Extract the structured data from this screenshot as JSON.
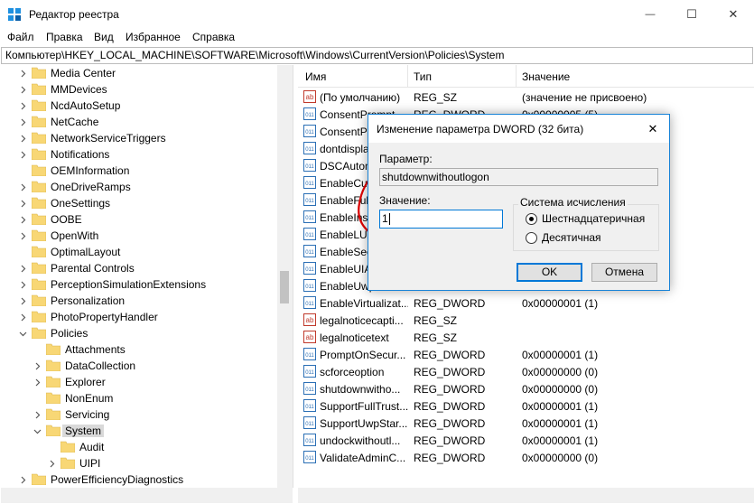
{
  "window": {
    "title": "Редактор реестра",
    "controls": {
      "minimize": "—",
      "maximize": "☐",
      "close": "✕"
    }
  },
  "menu": [
    "Файл",
    "Правка",
    "Вид",
    "Избранное",
    "Справка"
  ],
  "address": "Компьютер\\HKEY_LOCAL_MACHINE\\SOFTWARE\\Microsoft\\Windows\\CurrentVersion\\Policies\\System",
  "tree": [
    {
      "label": "Media Center",
      "expander": "collapsed"
    },
    {
      "label": "MMDevices",
      "expander": "collapsed"
    },
    {
      "label": "NcdAutoSetup",
      "expander": "collapsed"
    },
    {
      "label": "NetCache",
      "expander": "collapsed"
    },
    {
      "label": "NetworkServiceTriggers",
      "expander": "collapsed"
    },
    {
      "label": "Notifications",
      "expander": "collapsed"
    },
    {
      "label": "OEMInformation",
      "expander": "none"
    },
    {
      "label": "OneDriveRamps",
      "expander": "collapsed"
    },
    {
      "label": "OneSettings",
      "expander": "collapsed"
    },
    {
      "label": "OOBE",
      "expander": "collapsed"
    },
    {
      "label": "OpenWith",
      "expander": "collapsed"
    },
    {
      "label": "OptimalLayout",
      "expander": "none"
    },
    {
      "label": "Parental Controls",
      "expander": "collapsed"
    },
    {
      "label": "PerceptionSimulationExtensions",
      "expander": "collapsed"
    },
    {
      "label": "Personalization",
      "expander": "collapsed"
    },
    {
      "label": "PhotoPropertyHandler",
      "expander": "collapsed"
    },
    {
      "label": "Policies",
      "expander": "expanded"
    },
    {
      "label": "Attachments",
      "expander": "none"
    },
    {
      "label": "DataCollection",
      "expander": "collapsed"
    },
    {
      "label": "Explorer",
      "expander": "collapsed"
    },
    {
      "label": "NonEnum",
      "expander": "none"
    },
    {
      "label": "Servicing",
      "expander": "collapsed"
    },
    {
      "label": "System",
      "expander": "expanded",
      "selected": true
    },
    {
      "label": "Audit",
      "expander": "none"
    },
    {
      "label": "UIPI",
      "expander": "collapsed"
    },
    {
      "label": "PowerEfficiencyDiagnostics",
      "expander": "collapsed"
    }
  ],
  "list": {
    "headers": [
      "Имя",
      "Тип",
      "Значение"
    ],
    "rows": [
      {
        "icon": "string",
        "name": "(По умолчанию)",
        "type": "REG_SZ",
        "value": "(значение не присвоено)"
      },
      {
        "icon": "dword",
        "name": "ConsentPrompt...",
        "type": "REG_DWORD",
        "value": "0x00000005 (5)"
      },
      {
        "icon": "dword",
        "name": "ConsentPr...",
        "type": "",
        "value": ""
      },
      {
        "icon": "dword",
        "name": "dontdispla...",
        "type": "",
        "value": ""
      },
      {
        "icon": "dword",
        "name": "DSCAutom...",
        "type": "",
        "value": ""
      },
      {
        "icon": "dword",
        "name": "EnableCur...",
        "type": "",
        "value": ""
      },
      {
        "icon": "dword",
        "name": "EnableFull...",
        "type": "",
        "value": ""
      },
      {
        "icon": "dword",
        "name": "EnableInst...",
        "type": "",
        "value": ""
      },
      {
        "icon": "dword",
        "name": "EnableLUA",
        "type": "",
        "value": ""
      },
      {
        "icon": "dword",
        "name": "EnableSec...",
        "type": "",
        "value": ""
      },
      {
        "icon": "dword",
        "name": "EnableUIA...",
        "type": "",
        "value": ""
      },
      {
        "icon": "dword",
        "name": "EnableUwp...",
        "type": "",
        "value": ""
      },
      {
        "icon": "dword",
        "name": "EnableVirtualizat...",
        "type": "REG_DWORD",
        "value": "0x00000001 (1)"
      },
      {
        "icon": "string",
        "name": "legalnoticecapti...",
        "type": "REG_SZ",
        "value": ""
      },
      {
        "icon": "string",
        "name": "legalnoticetext",
        "type": "REG_SZ",
        "value": ""
      },
      {
        "icon": "dword",
        "name": "PromptOnSecur...",
        "type": "REG_DWORD",
        "value": "0x00000001 (1)"
      },
      {
        "icon": "dword",
        "name": "scforceoption",
        "type": "REG_DWORD",
        "value": "0x00000000 (0)"
      },
      {
        "icon": "dword",
        "name": "shutdownwitho...",
        "type": "REG_DWORD",
        "value": "0x00000000 (0)"
      },
      {
        "icon": "dword",
        "name": "SupportFullTrust...",
        "type": "REG_DWORD",
        "value": "0x00000001 (1)"
      },
      {
        "icon": "dword",
        "name": "SupportUwpStar...",
        "type": "REG_DWORD",
        "value": "0x00000001 (1)"
      },
      {
        "icon": "dword",
        "name": "undockwithoutl...",
        "type": "REG_DWORD",
        "value": "0x00000001 (1)"
      },
      {
        "icon": "dword",
        "name": "ValidateAdminC...",
        "type": "REG_DWORD",
        "value": "0x00000000 (0)"
      }
    ]
  },
  "dialog": {
    "title": "Изменение параметра DWORD (32 бита)",
    "param_label": "Параметр:",
    "param_value": "shutdownwithoutlogon",
    "value_label": "Значение:",
    "value": "1",
    "base_title": "Система исчисления",
    "base_options": [
      {
        "label": "Шестнадцатеричная",
        "selected": true
      },
      {
        "label": "Десятичная",
        "selected": false
      }
    ],
    "ok": "OK",
    "cancel": "Отмена",
    "close": "✕"
  },
  "colors": {
    "accent": "#0078d7",
    "folder": "#f8d775",
    "annotation": "#e00000",
    "string_icon": "#c0392b",
    "dword_icon": "#2b6fb5"
  }
}
